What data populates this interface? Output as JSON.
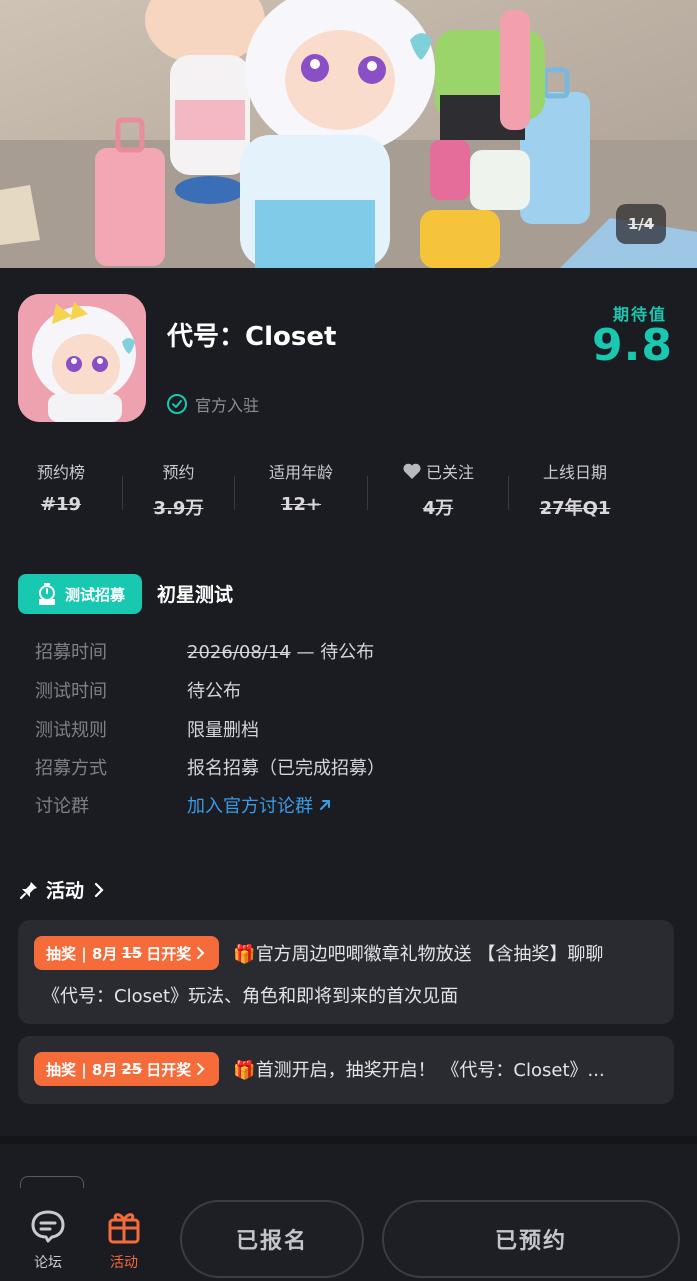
{
  "banner": {
    "counter": "1/4"
  },
  "game": {
    "title": "代号：Closet",
    "official_badge": "官方入驻",
    "expect_label": "期待值",
    "expect_score": "9.8"
  },
  "stats": [
    {
      "label": "预约榜",
      "value": "#19"
    },
    {
      "label": "预约",
      "value": "3.9万"
    },
    {
      "label": "适用年龄",
      "value": "12+"
    },
    {
      "label": "已关注",
      "value": "4万",
      "icon": "heart-icon"
    },
    {
      "label": "上线日期",
      "value": "27年Q1"
    }
  ],
  "test": {
    "badge_label": "测试招募",
    "name": "初星测试",
    "rows": [
      {
        "key": "招募时间",
        "value_date": "2026/08/14",
        "value_rest": " — 待公布"
      },
      {
        "key": "测试时间",
        "value": "待公布"
      },
      {
        "key": "测试规则",
        "value": "限量删档"
      },
      {
        "key": "招募方式",
        "value": "报名招募（已完成招募）"
      },
      {
        "key": "讨论群",
        "value": "加入官方讨论群"
      }
    ]
  },
  "activities": {
    "header": "活动",
    "items": [
      {
        "tag_prefix": "抽奖 | 8月",
        "tag_day": "15",
        "tag_suffix": "日开奖",
        "line1": "官方周边吧唧徽章礼物放送 【含抽奖】聊聊",
        "line2": "《代号：Closet》玩法、角色和即将到来的首次见面"
      },
      {
        "tag_prefix": "抽奖 | 8月",
        "tag_day": "25",
        "tag_suffix": "日开奖",
        "line1": "首测开启，抽奖开启！ 《代号：Closet》..."
      }
    ]
  },
  "bottom_nav": {
    "forum_label": "论坛",
    "activity_label": "活动",
    "registered_button": "已报名",
    "reserved_button": "已预约"
  },
  "colors": {
    "accent": "#19c8b0",
    "lottery": "#f56b3a",
    "link": "#3b9be6",
    "background": "#1b1c22"
  }
}
